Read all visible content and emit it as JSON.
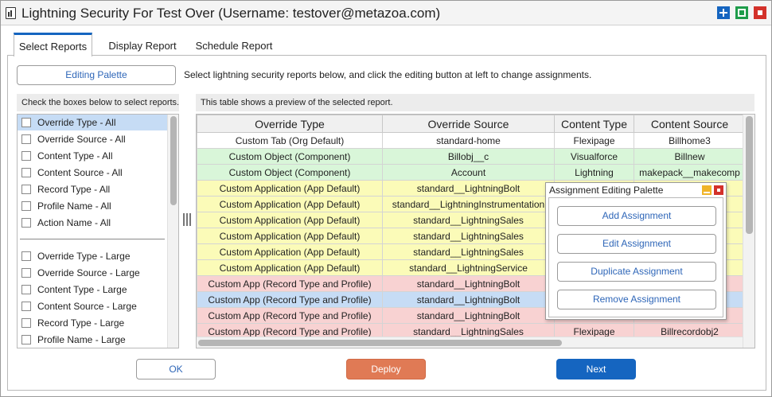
{
  "window": {
    "title": "Lightning Security For Test Over (Username: testover@metazoa.com)",
    "controls": [
      "maximize-icon",
      "restore-icon",
      "close-icon"
    ],
    "colors": {
      "maximize": "#1565c0",
      "restore": "#1e9c4a",
      "close": "#d3312a"
    }
  },
  "tabs": [
    {
      "label": "Select Reports",
      "active": true
    },
    {
      "label": "Display Report",
      "active": false
    },
    {
      "label": "Schedule Report",
      "active": false
    }
  ],
  "toolbar": {
    "editing_palette_label": "Editing Palette",
    "instruction": "Select lightning security reports below, and click the editing button at left to change assignments."
  },
  "left_panel": {
    "header": "Check the boxes below to select reports.",
    "group_all": [
      {
        "label": "Override Type - All",
        "checked": false,
        "selected": true
      },
      {
        "label": "Override Source - All",
        "checked": false
      },
      {
        "label": "Content Type - All",
        "checked": false
      },
      {
        "label": "Content Source - All",
        "checked": false
      },
      {
        "label": "Record Type - All",
        "checked": false
      },
      {
        "label": "Profile Name - All",
        "checked": false
      },
      {
        "label": "Action Name - All",
        "checked": false
      }
    ],
    "group_large": [
      {
        "label": "Override Type - Large",
        "checked": false
      },
      {
        "label": "Override Source - Large",
        "checked": false
      },
      {
        "label": "Content Type - Large",
        "checked": false
      },
      {
        "label": "Content Source - Large",
        "checked": false
      },
      {
        "label": "Record Type - Large",
        "checked": false
      },
      {
        "label": "Profile Name - Large",
        "checked": false
      }
    ]
  },
  "right_panel": {
    "header": "This table shows a preview of the selected report.",
    "columns": [
      "Override Type",
      "Override Source",
      "Content Type",
      "Content Source"
    ],
    "rows": [
      {
        "color": "white",
        "cells": [
          "Custom Tab (Org Default)",
          "standard-home",
          "Flexipage",
          "Billhome3"
        ]
      },
      {
        "color": "green",
        "cells": [
          "Custom Object (Component)",
          "Billobj__c",
          "Visualforce",
          "Billnew"
        ]
      },
      {
        "color": "green",
        "cells": [
          "Custom Object (Component)",
          "Account",
          "Lightning",
          "makepack__makecomp"
        ]
      },
      {
        "color": "yellow",
        "cells": [
          "Custom Application (App Default)",
          "standard__LightningBolt",
          "",
          ""
        ]
      },
      {
        "color": "yellow",
        "cells": [
          "Custom Application (App Default)",
          "standard__LightningInstrumentation",
          "",
          ""
        ]
      },
      {
        "color": "yellow",
        "cells": [
          "Custom Application (App Default)",
          "standard__LightningSales",
          "",
          ""
        ]
      },
      {
        "color": "yellow",
        "cells": [
          "Custom Application (App Default)",
          "standard__LightningSales",
          "",
          ""
        ]
      },
      {
        "color": "yellow",
        "cells": [
          "Custom Application (App Default)",
          "standard__LightningSales",
          "",
          ""
        ]
      },
      {
        "color": "yellow",
        "cells": [
          "Custom Application (App Default)",
          "standard__LightningService",
          "",
          ""
        ]
      },
      {
        "color": "red",
        "cells": [
          "Custom App (Record Type and Profile)",
          "standard__LightningBolt",
          "",
          ""
        ]
      },
      {
        "color": "blue",
        "cells": [
          "Custom App (Record Type and Profile)",
          "standard__LightningBolt",
          "",
          ""
        ]
      },
      {
        "color": "red",
        "cells": [
          "Custom App (Record Type and Profile)",
          "standard__LightningBolt",
          "",
          ""
        ]
      },
      {
        "color": "red",
        "cells": [
          "Custom App (Record Type and Profile)",
          "standard__LightningSales",
          "Flexipage",
          "Billrecordobj2"
        ]
      }
    ],
    "row_colors": {
      "white": "#ffffff",
      "green": "#d9f6d9",
      "yellow": "#fbfbb8",
      "red": "#f8d2d2",
      "blue": "#c6dcf5"
    }
  },
  "palette": {
    "title": "Assignment Editing Palette",
    "buttons": [
      "Add Assignment",
      "Edit Assignment",
      "Duplicate Assignment",
      "Remove Assignment"
    ]
  },
  "footer": {
    "ok_label": "OK",
    "deploy_label": "Deploy",
    "next_label": "Next",
    "colors": {
      "deploy": "#e07a55",
      "next": "#1565c0"
    }
  }
}
